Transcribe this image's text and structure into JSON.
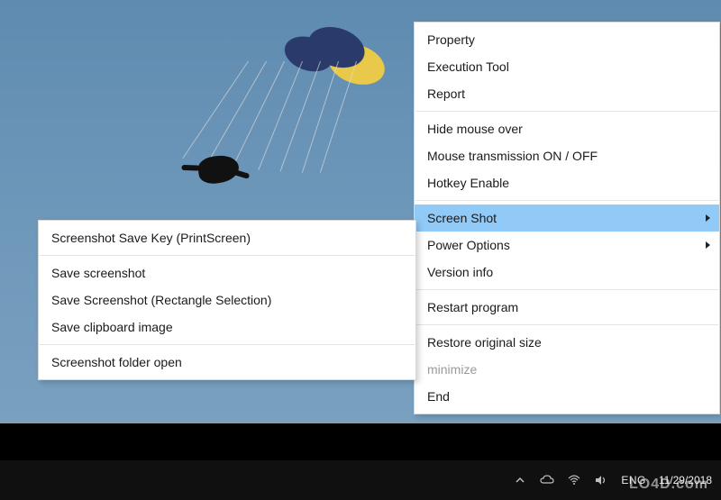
{
  "main_menu": {
    "group1": [
      {
        "label": "Property"
      },
      {
        "label": "Execution Tool"
      },
      {
        "label": "Report"
      }
    ],
    "group2": [
      {
        "label": "Hide mouse over"
      },
      {
        "label": "Mouse transmission ON / OFF"
      },
      {
        "label": "Hotkey Enable"
      }
    ],
    "group3": [
      {
        "label": "Screen Shot",
        "highlight": true,
        "has_sub": true
      },
      {
        "label": "Power Options",
        "has_sub": true
      },
      {
        "label": "Version info"
      }
    ],
    "group4": [
      {
        "label": "Restart program"
      }
    ],
    "group5": [
      {
        "label": "Restore original size"
      },
      {
        "label": "minimize",
        "disabled": true
      },
      {
        "label": "End"
      }
    ]
  },
  "sub_menu": {
    "group1": [
      {
        "label": "Screenshot Save Key (PrintScreen)"
      }
    ],
    "group2": [
      {
        "label": "Save screenshot"
      },
      {
        "label": "Save Screenshot (Rectangle Selection)"
      },
      {
        "label": "Save clipboard image"
      }
    ],
    "group3": [
      {
        "label": "Screenshot folder open"
      }
    ]
  },
  "taskbar": {
    "lang": "ENG",
    "date": "11/29/2018"
  },
  "watermark": "LO4D.com"
}
